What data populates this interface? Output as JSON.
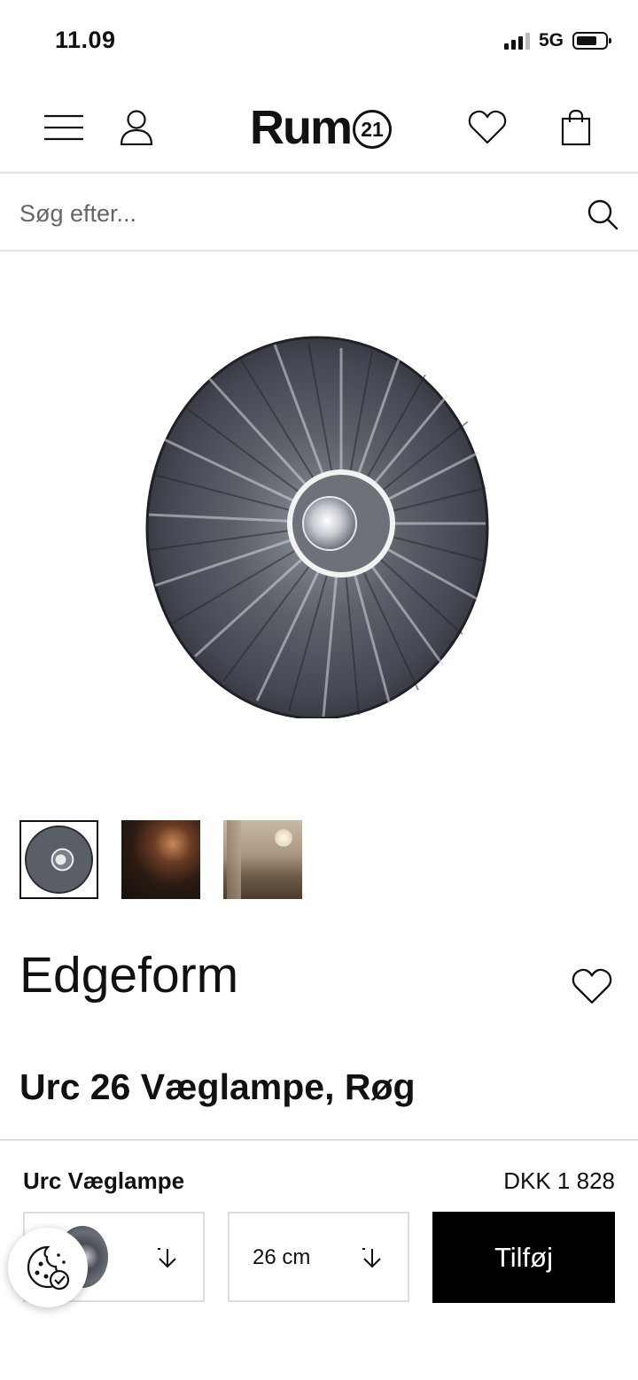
{
  "status_bar": {
    "time": "11.09",
    "network": "5G"
  },
  "header": {
    "logo_text": "Rum",
    "logo_badge": "21"
  },
  "search": {
    "placeholder": "Søg efter..."
  },
  "product": {
    "brand": "Edgeform",
    "title": "Urc 26 Væglampe, Røg"
  },
  "gallery": {
    "thumbnails": [
      "lamp-front",
      "lamp-dark-room",
      "lamp-living-room"
    ],
    "active_index": 0
  },
  "sticky_bar": {
    "name": "Urc Væglampe",
    "price": "DKK 1 828",
    "size_value": "26 cm",
    "add_label": "Tilføj"
  }
}
